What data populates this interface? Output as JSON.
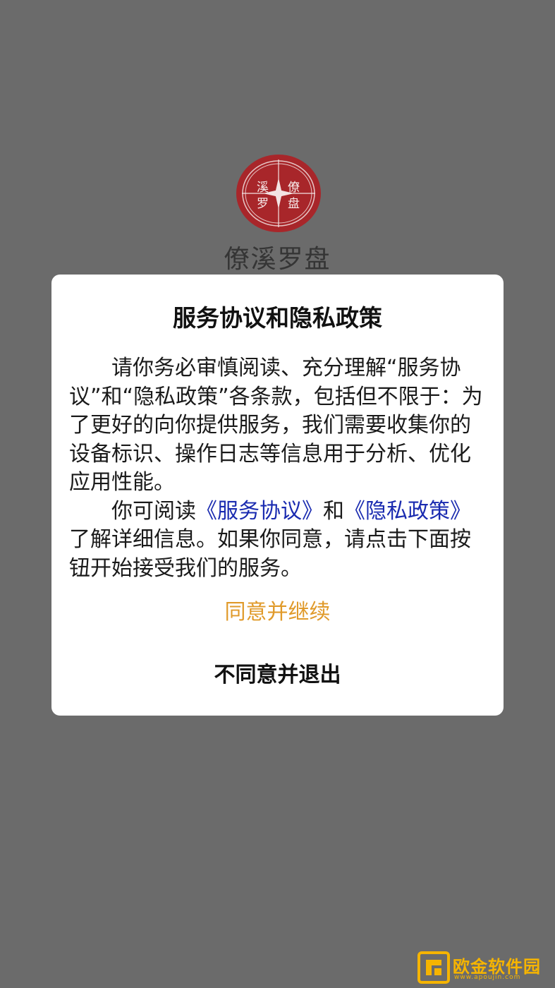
{
  "app": {
    "name": "僚溪罗盘",
    "logo_characters": [
      "僚",
      "溪",
      "罗",
      "盘"
    ]
  },
  "dialog": {
    "title": "服务协议和隐私政策",
    "paragraph1": "请你务必审慎阅读、充分理解“服务协议”和“隐私政策”各条款，包括但不限于：为了更好的向你提供服务，我们需要收集你的设备标识、操作日志等信息用于分析、优化应用性能。",
    "paragraph2_prefix": "你可阅读",
    "service_link": "《服务协议》",
    "paragraph2_and": "和",
    "privacy_link": "《隐私政策》",
    "paragraph2_suffix": "了解详细信息。如果你同意，请点击下面按钮开始接受我们的服务。",
    "agree_label": "同意并继续",
    "disagree_label": "不同意并退出"
  },
  "watermark": {
    "text": "欧金软件园",
    "url": "www.apoujin.com"
  },
  "colors": {
    "backdrop": "#6b6b6b",
    "agree": "#e09a2a",
    "link": "#1a2bb0",
    "logo": "#a8262a",
    "watermark": "#f6b400"
  }
}
